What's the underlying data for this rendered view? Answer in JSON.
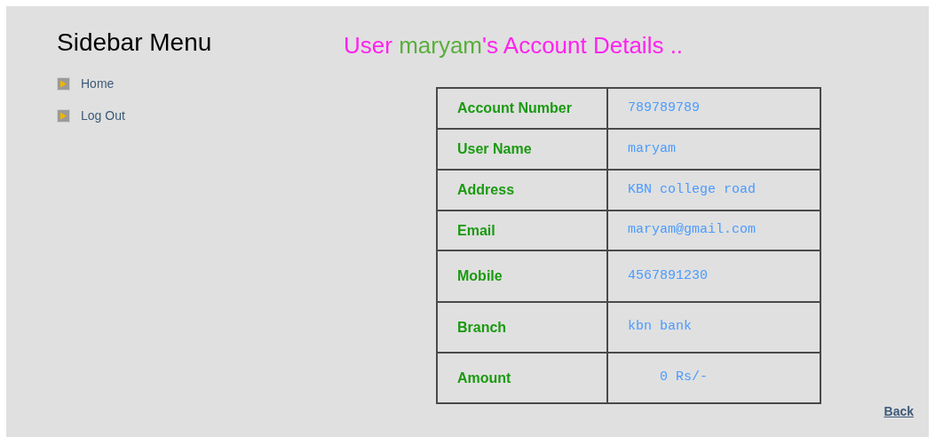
{
  "sidebar": {
    "title": "Sidebar Menu",
    "items": [
      {
        "label": "Home"
      },
      {
        "label": "Log Out"
      }
    ]
  },
  "heading": {
    "before": "User ",
    "name": "maryam",
    "after": "'s Account Details .."
  },
  "details": [
    {
      "label": "Account Number",
      "value": "789789789"
    },
    {
      "label": "User Name",
      "value": "maryam"
    },
    {
      "label": "Address",
      "value": "KBN college road"
    },
    {
      "label": "Email",
      "value": "maryam@gmail.com"
    },
    {
      "label": "Mobile",
      "value": "4567891230"
    },
    {
      "label": "Branch",
      "value": "kbn bank"
    },
    {
      "label": "Amount",
      "value": "    0 Rs/-"
    }
  ],
  "back_link": "Back"
}
